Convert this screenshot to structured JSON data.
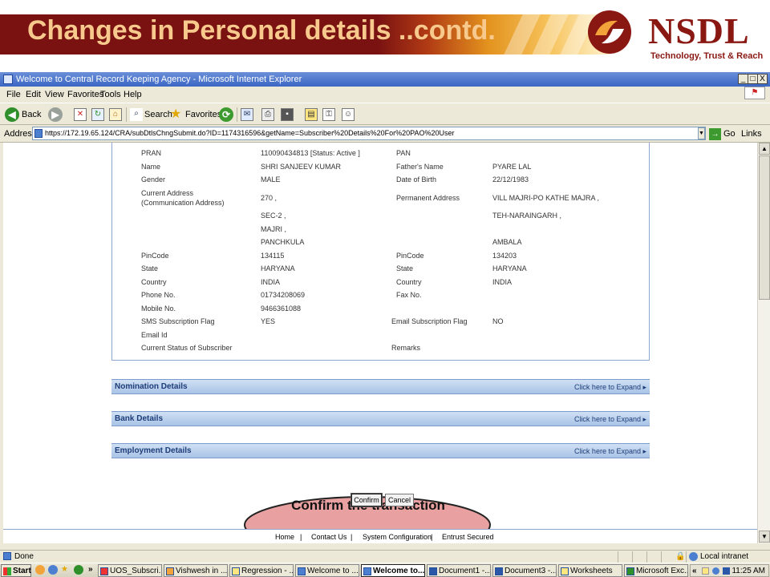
{
  "slide": {
    "title": "Changes in Personal details ..contd.",
    "brand": {
      "name": "NSDL",
      "tagline": "Technology, Trust & Reach"
    }
  },
  "browser": {
    "window_title": "Welcome to Central Record Keeping Agency - Microsoft Internet Explorer",
    "window_buttons": [
      "_",
      "□",
      "X"
    ],
    "menu": [
      "File",
      "Edit",
      "View",
      "Favorites",
      "Tools",
      "Help"
    ],
    "toolbar": {
      "back": "Back",
      "search": "Search",
      "favorites": "Favorites"
    },
    "address": {
      "label": "Address",
      "url": "https://172.19.65.124/CRA/subDtlsChngSubmit.do?ID=1174316596&getName=Subscriber%20Details%20For%20PAO%20User",
      "go": "Go",
      "links": "Links"
    },
    "status": {
      "text": "Done",
      "zone": "Local intranet"
    }
  },
  "details": {
    "left": [
      {
        "label": "PRAN",
        "value": "110090434813 [Status: Active ]"
      },
      {
        "label": "Name",
        "value": "SHRI  SANJEEV   KUMAR"
      },
      {
        "label": "Gender",
        "value": "MALE"
      },
      {
        "label": "Current Address",
        "label2": "(Communication Address)",
        "value": "270 ,"
      },
      {
        "label": "",
        "value": "SEC-2 ,"
      },
      {
        "label": "",
        "value": "MAJRI ,"
      },
      {
        "label": "",
        "value": "PANCHKULA"
      },
      {
        "label": "PinCode",
        "value": "134115"
      },
      {
        "label": "State",
        "value": "HARYANA"
      },
      {
        "label": "Country",
        "value": "INDIA"
      },
      {
        "label": "Phone No.",
        "value": "01734208069"
      },
      {
        "label": "Mobile No.",
        "value": "9466361088"
      },
      {
        "label": "SMS Subscription Flag",
        "value": "YES"
      },
      {
        "label": "Email Id",
        "value": ""
      },
      {
        "label": "Current Status of Subscriber",
        "value": ""
      }
    ],
    "right": [
      {
        "label": "PAN",
        "value": ""
      },
      {
        "label": "Father's Name",
        "value": "PYARE LAL"
      },
      {
        "label": "Date of Birth",
        "value": "22/12/1983"
      },
      {
        "label": "Permanent Address",
        "value": "VILL MAJRI-PO KATHE MAJRA ,"
      },
      {
        "label": "",
        "value": "TEH-NARAINGARH ,"
      },
      {
        "label": "",
        "value": "AMBALA"
      },
      {
        "label": "PinCode",
        "value": "134203"
      },
      {
        "label": "State",
        "value": "HARYANA"
      },
      {
        "label": "Country",
        "value": "INDIA"
      },
      {
        "label": "Fax No.",
        "value": ""
      },
      {
        "label": "Email Subscription Flag",
        "value": "NO"
      },
      {
        "label": "Remarks",
        "value": ""
      }
    ]
  },
  "sections": [
    {
      "title": "Nomination Details",
      "expand": "Click here to Expand ▸"
    },
    {
      "title": "Bank Details",
      "expand": "Click here to Expand ▸"
    },
    {
      "title": "Employment Details",
      "expand": "Click here to Expand ▸"
    }
  ],
  "buttons": {
    "confirm": "Confirm",
    "cancel": "Cancel"
  },
  "callout": {
    "text": "Confirm the transaction"
  },
  "footer_links": [
    "Home",
    "|",
    "Contact Us",
    "|",
    "System Configuration",
    "|",
    "Entrust Secured"
  ],
  "taskbar": {
    "start": "Start",
    "items": [
      "UOS_Subscri...",
      "Vishwesh in ...",
      "Regression - ...",
      "Welcome to ...",
      "Welcome to...",
      "Document1 -...",
      "Document3 -...",
      "Worksheets",
      "Microsoft Exc..."
    ],
    "clock": "11:25 AM"
  },
  "colors": {
    "brand_red": "#8a1812",
    "title_text": "#f7c98d",
    "section_bar": "#a9c3e6",
    "callout_fill": "#e8a0a0"
  }
}
